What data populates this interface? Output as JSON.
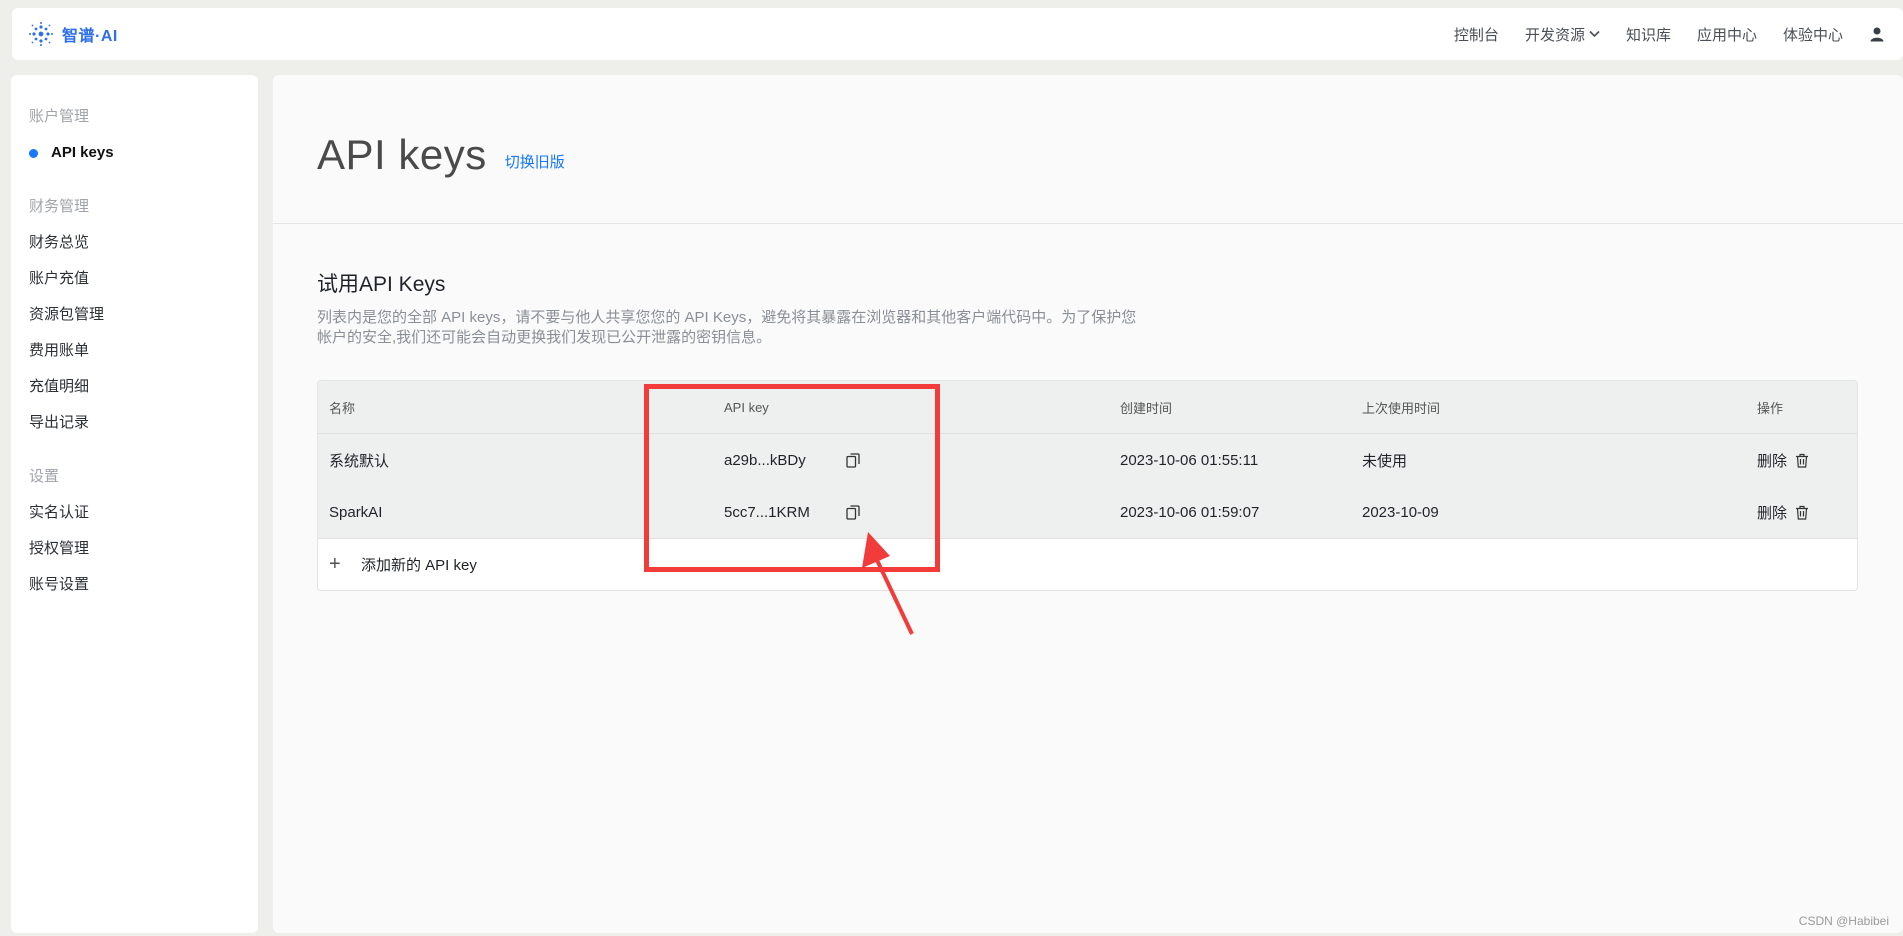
{
  "topbar": {
    "logo_text": "智谱·AI",
    "nav": [
      {
        "label": "控制台"
      },
      {
        "label": "开发资源",
        "has_dropdown": true
      },
      {
        "label": "知识库"
      },
      {
        "label": "应用中心"
      },
      {
        "label": "体验中心"
      }
    ]
  },
  "sidebar": {
    "sections": [
      {
        "title": "账户管理",
        "items": [
          {
            "label": "API keys",
            "active": true
          }
        ]
      },
      {
        "title": "财务管理",
        "items": [
          {
            "label": "财务总览"
          },
          {
            "label": "账户充值"
          },
          {
            "label": "资源包管理"
          },
          {
            "label": "费用账单"
          },
          {
            "label": "充值明细"
          },
          {
            "label": "导出记录"
          }
        ]
      },
      {
        "title": "设置",
        "items": [
          {
            "label": "实名认证"
          },
          {
            "label": "授权管理"
          },
          {
            "label": "账号设置"
          }
        ]
      }
    ]
  },
  "main": {
    "title": "API keys",
    "switch_link": "切换旧版",
    "section_title": "试用API Keys",
    "section_desc": "列表内是您的全部 API keys，请不要与他人共享您您的 API Keys，避免将其暴露在浏览器和其他客户端代码中。为了保护您帐户的安全,我们还可能会自动更换我们发现已公开泄露的密钥信息。",
    "table": {
      "headers": {
        "name": "名称",
        "key": "API key",
        "created": "创建时间",
        "last_used": "上次使用时间",
        "actions": "操作"
      },
      "rows": [
        {
          "name": "系统默认",
          "key": "a29b...kBDy",
          "created": "2023-10-06 01:55:11",
          "last_used": "未使用",
          "action": "删除"
        },
        {
          "name": "SparkAI",
          "key": "5cc7...1KRM",
          "created": "2023-10-06 01:59:07",
          "last_used": "2023-10-09",
          "action": "删除"
        }
      ],
      "add_label": "添加新的 API key"
    }
  },
  "annotation": {
    "color": "#f23b3b"
  },
  "watermark": "CSDN @Habibei",
  "colors": {
    "accent": "#1677ff",
    "logo": "#2f6fec"
  }
}
